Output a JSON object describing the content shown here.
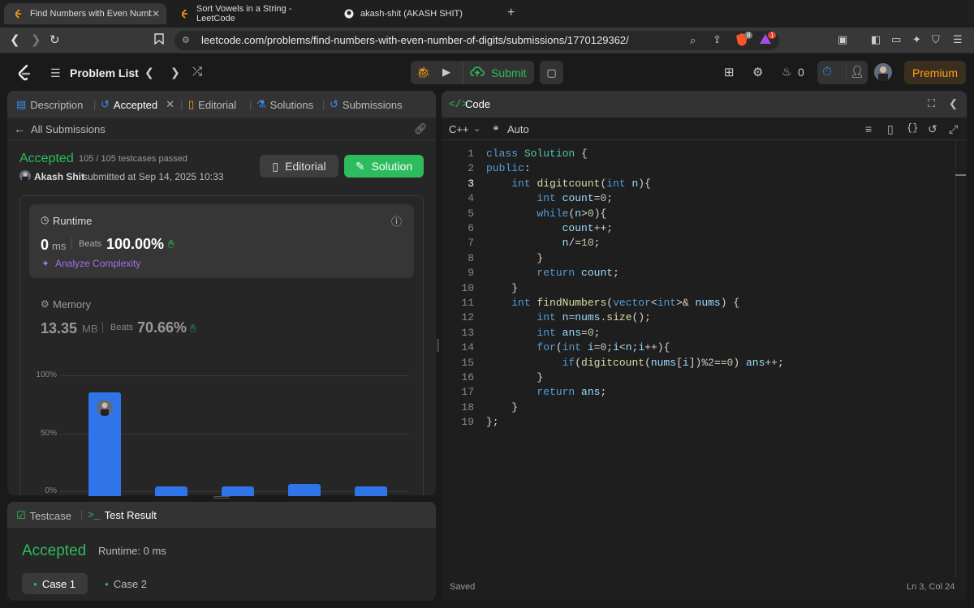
{
  "browser": {
    "tabs": [
      {
        "title": "Find Numbers with Even Numbe",
        "active": true
      },
      {
        "title": "Sort Vowels in a String - LeetCode",
        "active": false
      },
      {
        "title": "akash-shit (AKASH SHIT)",
        "active": false
      }
    ],
    "url": "leetcode.com/problems/find-numbers-with-even-number-of-digits/submissions/1770129362/",
    "shield_count": "8",
    "alert_count": "1"
  },
  "header": {
    "problem_list": "Problem List",
    "submit_label": "Submit",
    "streak_count": "0",
    "premium_label": "Premium"
  },
  "left_tabs": [
    "Description",
    "Accepted",
    "Editorial",
    "Solutions",
    "Submissions"
  ],
  "submission": {
    "back_label": "All Submissions",
    "status": "Accepted",
    "testcases": "105 / 105 testcases passed",
    "user": "Akash Shit",
    "submitted_at": "submitted at Sep 14, 2025 10:33",
    "editorial_btn": "Editorial",
    "solution_btn": "Solution",
    "runtime_label": "Runtime",
    "runtime_value": "0",
    "runtime_unit": "ms",
    "beats_label": "Beats",
    "runtime_beats": "100.00%",
    "analyze_label": "Analyze Complexity",
    "memory_label": "Memory",
    "memory_value": "13.35",
    "memory_unit": "MB",
    "memory_beats": "70.66%"
  },
  "chart_data": {
    "type": "bar",
    "y_ticks": [
      "100%",
      "50%",
      "0%"
    ],
    "values": [
      85,
      4,
      4,
      6,
      4
    ],
    "ylim": [
      0,
      100
    ]
  },
  "testpanel": {
    "testcase_tab": "Testcase",
    "result_tab": "Test Result",
    "status": "Accepted",
    "runtime": "Runtime: 0 ms",
    "cases": [
      "Case 1",
      "Case 2"
    ]
  },
  "code_panel": {
    "title": "Code",
    "language": "C++",
    "mode": "Auto",
    "saved": "Saved",
    "cursor": "Ln 3, Col 24",
    "lines": [
      "class Solution {",
      "public:",
      "    int digitcount(int n){",
      "        int count=0;",
      "        while(n>0){",
      "            count++;",
      "            n/=10;",
      "        }",
      "        return count;",
      "    }",
      "    int findNumbers(vector<int>& nums) {",
      "        int n=nums.size();",
      "        int ans=0;",
      "        for(int i=0;i<n;i++){",
      "            if(digitcount(nums[i])%2==0) ans++;",
      "        }",
      "        return ans;",
      "    }",
      "};"
    ]
  },
  "colors": {
    "accepted": "#2cbb5d",
    "bar": "#2f74e8",
    "premium": "#ffa116"
  }
}
